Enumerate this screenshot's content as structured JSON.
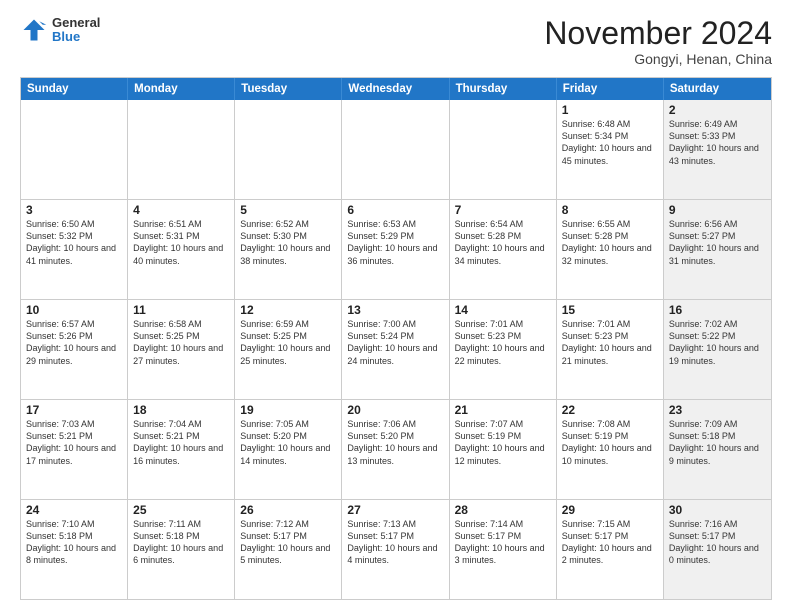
{
  "header": {
    "logo": {
      "general": "General",
      "blue": "Blue"
    },
    "title": "November 2024",
    "subtitle": "Gongyi, Henan, China"
  },
  "calendar": {
    "days_of_week": [
      "Sunday",
      "Monday",
      "Tuesday",
      "Wednesday",
      "Thursday",
      "Friday",
      "Saturday"
    ],
    "rows": [
      [
        {
          "day": "",
          "info": "",
          "shaded": false
        },
        {
          "day": "",
          "info": "",
          "shaded": false
        },
        {
          "day": "",
          "info": "",
          "shaded": false
        },
        {
          "day": "",
          "info": "",
          "shaded": false
        },
        {
          "day": "",
          "info": "",
          "shaded": false
        },
        {
          "day": "1",
          "info": "Sunrise: 6:48 AM\nSunset: 5:34 PM\nDaylight: 10 hours\nand 45 minutes.",
          "shaded": false
        },
        {
          "day": "2",
          "info": "Sunrise: 6:49 AM\nSunset: 5:33 PM\nDaylight: 10 hours\nand 43 minutes.",
          "shaded": true
        }
      ],
      [
        {
          "day": "3",
          "info": "Sunrise: 6:50 AM\nSunset: 5:32 PM\nDaylight: 10 hours\nand 41 minutes.",
          "shaded": false
        },
        {
          "day": "4",
          "info": "Sunrise: 6:51 AM\nSunset: 5:31 PM\nDaylight: 10 hours\nand 40 minutes.",
          "shaded": false
        },
        {
          "day": "5",
          "info": "Sunrise: 6:52 AM\nSunset: 5:30 PM\nDaylight: 10 hours\nand 38 minutes.",
          "shaded": false
        },
        {
          "day": "6",
          "info": "Sunrise: 6:53 AM\nSunset: 5:29 PM\nDaylight: 10 hours\nand 36 minutes.",
          "shaded": false
        },
        {
          "day": "7",
          "info": "Sunrise: 6:54 AM\nSunset: 5:28 PM\nDaylight: 10 hours\nand 34 minutes.",
          "shaded": false
        },
        {
          "day": "8",
          "info": "Sunrise: 6:55 AM\nSunset: 5:28 PM\nDaylight: 10 hours\nand 32 minutes.",
          "shaded": false
        },
        {
          "day": "9",
          "info": "Sunrise: 6:56 AM\nSunset: 5:27 PM\nDaylight: 10 hours\nand 31 minutes.",
          "shaded": true
        }
      ],
      [
        {
          "day": "10",
          "info": "Sunrise: 6:57 AM\nSunset: 5:26 PM\nDaylight: 10 hours\nand 29 minutes.",
          "shaded": false
        },
        {
          "day": "11",
          "info": "Sunrise: 6:58 AM\nSunset: 5:25 PM\nDaylight: 10 hours\nand 27 minutes.",
          "shaded": false
        },
        {
          "day": "12",
          "info": "Sunrise: 6:59 AM\nSunset: 5:25 PM\nDaylight: 10 hours\nand 25 minutes.",
          "shaded": false
        },
        {
          "day": "13",
          "info": "Sunrise: 7:00 AM\nSunset: 5:24 PM\nDaylight: 10 hours\nand 24 minutes.",
          "shaded": false
        },
        {
          "day": "14",
          "info": "Sunrise: 7:01 AM\nSunset: 5:23 PM\nDaylight: 10 hours\nand 22 minutes.",
          "shaded": false
        },
        {
          "day": "15",
          "info": "Sunrise: 7:01 AM\nSunset: 5:23 PM\nDaylight: 10 hours\nand 21 minutes.",
          "shaded": false
        },
        {
          "day": "16",
          "info": "Sunrise: 7:02 AM\nSunset: 5:22 PM\nDaylight: 10 hours\nand 19 minutes.",
          "shaded": true
        }
      ],
      [
        {
          "day": "17",
          "info": "Sunrise: 7:03 AM\nSunset: 5:21 PM\nDaylight: 10 hours\nand 17 minutes.",
          "shaded": false
        },
        {
          "day": "18",
          "info": "Sunrise: 7:04 AM\nSunset: 5:21 PM\nDaylight: 10 hours\nand 16 minutes.",
          "shaded": false
        },
        {
          "day": "19",
          "info": "Sunrise: 7:05 AM\nSunset: 5:20 PM\nDaylight: 10 hours\nand 14 minutes.",
          "shaded": false
        },
        {
          "day": "20",
          "info": "Sunrise: 7:06 AM\nSunset: 5:20 PM\nDaylight: 10 hours\nand 13 minutes.",
          "shaded": false
        },
        {
          "day": "21",
          "info": "Sunrise: 7:07 AM\nSunset: 5:19 PM\nDaylight: 10 hours\nand 12 minutes.",
          "shaded": false
        },
        {
          "day": "22",
          "info": "Sunrise: 7:08 AM\nSunset: 5:19 PM\nDaylight: 10 hours\nand 10 minutes.",
          "shaded": false
        },
        {
          "day": "23",
          "info": "Sunrise: 7:09 AM\nSunset: 5:18 PM\nDaylight: 10 hours\nand 9 minutes.",
          "shaded": true
        }
      ],
      [
        {
          "day": "24",
          "info": "Sunrise: 7:10 AM\nSunset: 5:18 PM\nDaylight: 10 hours\nand 8 minutes.",
          "shaded": false
        },
        {
          "day": "25",
          "info": "Sunrise: 7:11 AM\nSunset: 5:18 PM\nDaylight: 10 hours\nand 6 minutes.",
          "shaded": false
        },
        {
          "day": "26",
          "info": "Sunrise: 7:12 AM\nSunset: 5:17 PM\nDaylight: 10 hours\nand 5 minutes.",
          "shaded": false
        },
        {
          "day": "27",
          "info": "Sunrise: 7:13 AM\nSunset: 5:17 PM\nDaylight: 10 hours\nand 4 minutes.",
          "shaded": false
        },
        {
          "day": "28",
          "info": "Sunrise: 7:14 AM\nSunset: 5:17 PM\nDaylight: 10 hours\nand 3 minutes.",
          "shaded": false
        },
        {
          "day": "29",
          "info": "Sunrise: 7:15 AM\nSunset: 5:17 PM\nDaylight: 10 hours\nand 2 minutes.",
          "shaded": false
        },
        {
          "day": "30",
          "info": "Sunrise: 7:16 AM\nSunset: 5:17 PM\nDaylight: 10 hours\nand 0 minutes.",
          "shaded": true
        }
      ]
    ]
  }
}
